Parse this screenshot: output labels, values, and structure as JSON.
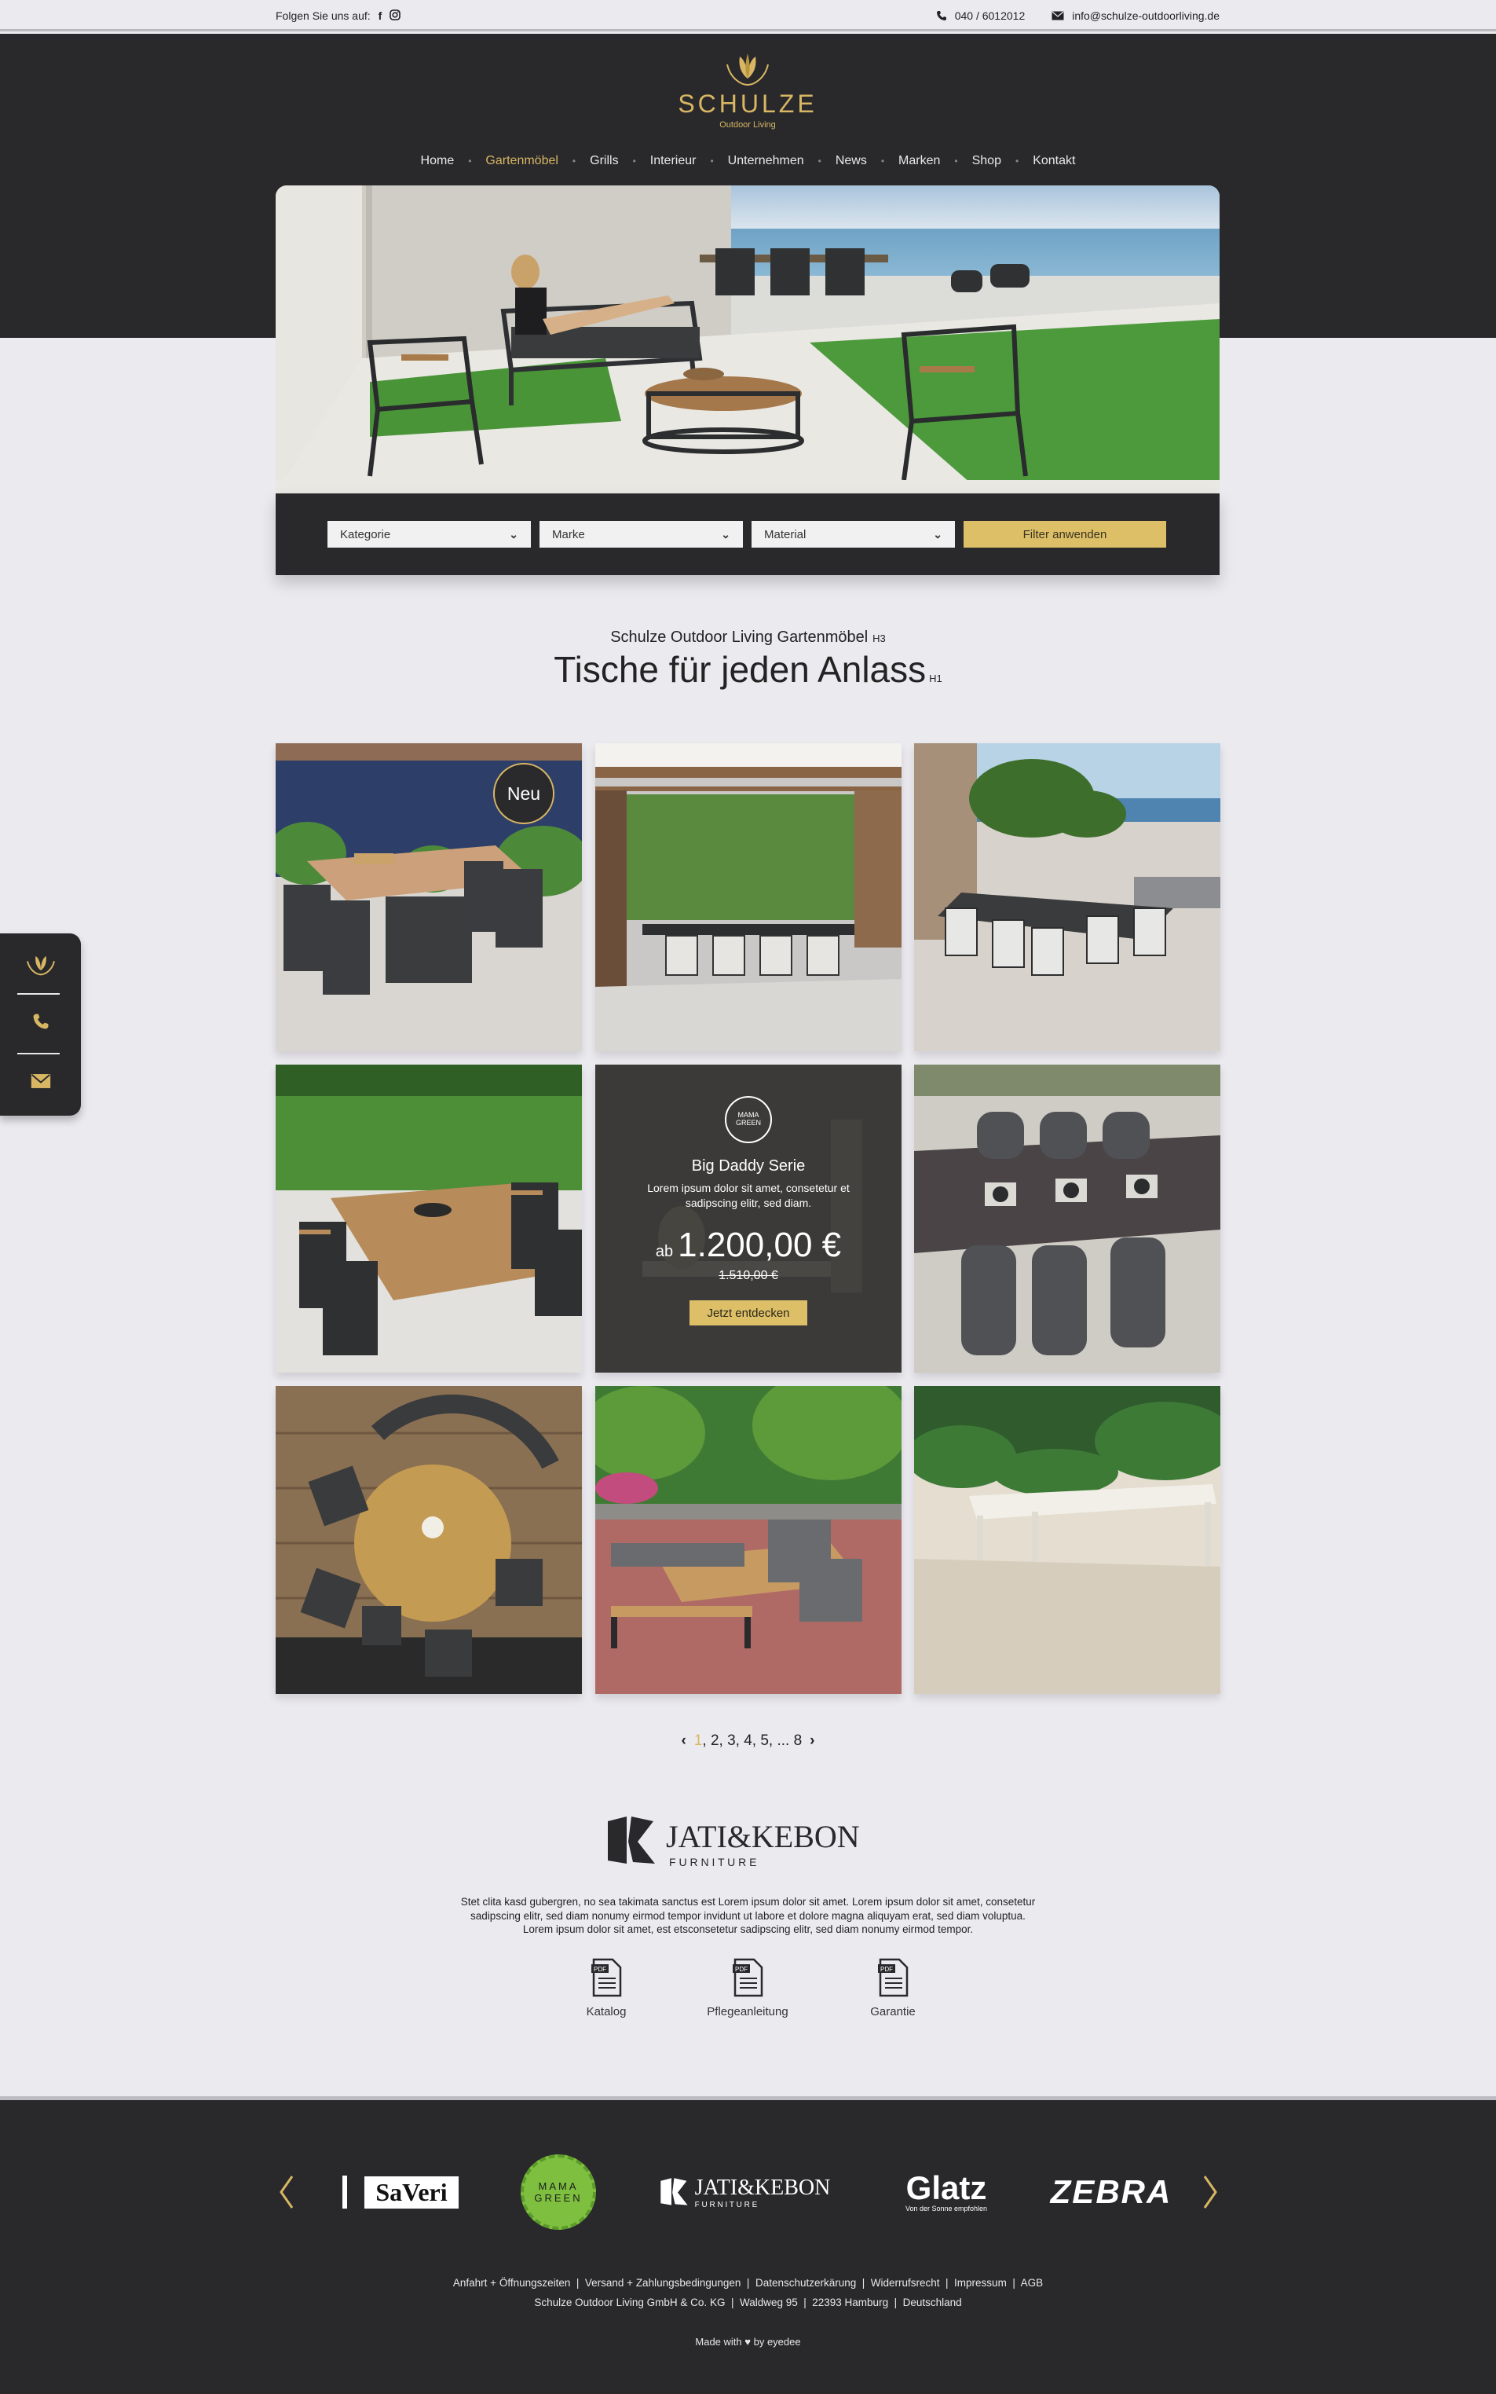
{
  "topbar": {
    "follow_label": "Folgen Sie uns auf:",
    "facebook_icon": "f",
    "phone": "040 / 6012012",
    "email": "info@schulze-outdoorliving.de"
  },
  "logo": {
    "brand": "SCHULZE",
    "sub": "Outdoor Living"
  },
  "nav": {
    "items": [
      "Home",
      "Gartenmöbel",
      "Grills",
      "Interieur",
      "Unternehmen",
      "News",
      "Marken",
      "Shop",
      "Kontakt"
    ]
  },
  "filters": {
    "kategorie": "Kategorie",
    "marke": "Marke",
    "material": "Material",
    "apply": "Filter anwenden"
  },
  "headings": {
    "subtitle": "Schulze Outdoor Living Gartenmöbel",
    "subtitle_tag": "H3",
    "title": "Tische für jeden Anlass",
    "title_tag": "H1"
  },
  "grid": {
    "new_badge": "Neu"
  },
  "promo": {
    "badge_line1": "MAMA",
    "badge_line2": "GREEN",
    "title": "Big Daddy Serie",
    "desc": "Lorem ipsum dolor sit amet, consetetur et sadipscing elitr, sed diam.",
    "price_prefix": "ab",
    "price": "1.200,00 €",
    "old_price": "1.510,00 €",
    "cta": "Jetzt entdecken"
  },
  "pagination": {
    "current": "1",
    "rest": ", 2, 3, 4, 5, ... 8"
  },
  "brand": {
    "name": "JATI&KEBON",
    "tag": "F U R N I T U R E",
    "desc_line1": "Stet clita kasd gubergren, no sea takimata sanctus est Lorem ipsum dolor sit amet. Lorem ipsum dolor sit amet, consetetur",
    "desc_line2": "sadipscing elitr, sed diam nonumy eirmod tempor invidunt ut labore et dolore magna aliquyam erat, sed diam voluptua.",
    "desc_line3": "Lorem ipsum dolor sit amet, est etsconsetetur sadipscing elitr, sed diam nonumy eirmod tempor.",
    "docs": [
      "Katalog",
      "Pflegeanleitung",
      "Garantie"
    ],
    "pdf_label": "PDF"
  },
  "footer": {
    "brands": {
      "saveri": "SaVeri",
      "mamagreen_1": "MAMA",
      "mamagreen_2": "GREEN",
      "jati": "JATI&KEBON",
      "jati_tag": "F U R N I T U R E",
      "glatz": "Glatz",
      "glatz_tag": "Von der Sonne empfohlen",
      "zebra": "ZEBRA"
    },
    "links": "Anfahrt + Öffnungszeiten  |  Versand + Zahlungsbedingungen  |  Datenschutzerkärung  |  Widerrufsrecht  |  Impressum  |  AGB",
    "address": "Schulze Outdoor Living GmbH & Co. KG  |  Waldweg 95  |  22393 Hamburg  |  Deutschland",
    "made_with": "Made with",
    "made_by": "by eyedee"
  },
  "colors": {
    "dark": "#29292c",
    "gold": "#dcbf67",
    "bg": "#ebeaef"
  }
}
